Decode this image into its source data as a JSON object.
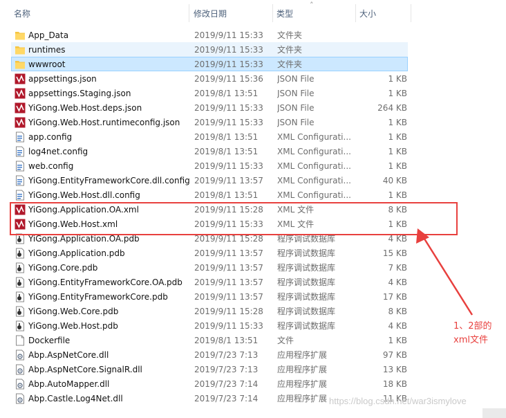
{
  "header": {
    "name": "名称",
    "date": "修改日期",
    "type": "类型",
    "size": "大小"
  },
  "files": [
    {
      "icon": "folder-icon",
      "name": "App_Data",
      "date": "2019/9/11 15:33",
      "type": "文件夹",
      "size": ""
    },
    {
      "icon": "folder-icon",
      "name": "runtimes",
      "date": "2019/9/11 15:33",
      "type": "文件夹",
      "size": ""
    },
    {
      "icon": "folder-icon",
      "name": "wwwroot",
      "date": "2019/9/11 15:33",
      "type": "文件夹",
      "size": ""
    },
    {
      "icon": "vs-file-icon",
      "name": "appsettings.json",
      "date": "2019/9/11 15:36",
      "type": "JSON File",
      "size": "1 KB"
    },
    {
      "icon": "vs-file-icon",
      "name": "appsettings.Staging.json",
      "date": "2019/8/1 13:51",
      "type": "JSON File",
      "size": "1 KB"
    },
    {
      "icon": "vs-file-icon",
      "name": "YiGong.Web.Host.deps.json",
      "date": "2019/9/11 15:33",
      "type": "JSON File",
      "size": "264 KB"
    },
    {
      "icon": "vs-file-icon",
      "name": "YiGong.Web.Host.runtimeconfig.json",
      "date": "2019/9/11 15:33",
      "type": "JSON File",
      "size": "1 KB"
    },
    {
      "icon": "config-file-icon",
      "name": "app.config",
      "date": "2019/8/1 13:51",
      "type": "XML Configurati...",
      "size": "1 KB"
    },
    {
      "icon": "config-file-icon",
      "name": "log4net.config",
      "date": "2019/8/1 13:51",
      "type": "XML Configurati...",
      "size": "1 KB"
    },
    {
      "icon": "config-file-icon",
      "name": "web.config",
      "date": "2019/9/11 15:33",
      "type": "XML Configurati...",
      "size": "1 KB"
    },
    {
      "icon": "config-file-icon",
      "name": "YiGong.EntityFrameworkCore.dll.config",
      "date": "2019/9/11 13:57",
      "type": "XML Configurati...",
      "size": "40 KB"
    },
    {
      "icon": "config-file-icon",
      "name": "YiGong.Web.Host.dll.config",
      "date": "2019/8/1 13:51",
      "type": "XML Configurati...",
      "size": "1 KB"
    },
    {
      "icon": "vs-file-icon",
      "name": "YiGong.Application.OA.xml",
      "date": "2019/9/11 15:28",
      "type": "XML 文件",
      "size": "8 KB"
    },
    {
      "icon": "vs-file-icon",
      "name": "YiGong.Web.Host.xml",
      "date": "2019/9/11 15:33",
      "type": "XML 文件",
      "size": "1 KB"
    },
    {
      "icon": "pdb-file-icon",
      "name": "YiGong.Application.OA.pdb",
      "date": "2019/9/11 15:28",
      "type": "程序调试数据库",
      "size": "4 KB"
    },
    {
      "icon": "pdb-file-icon",
      "name": "YiGong.Application.pdb",
      "date": "2019/9/11 13:57",
      "type": "程序调试数据库",
      "size": "15 KB"
    },
    {
      "icon": "pdb-file-icon",
      "name": "YiGong.Core.pdb",
      "date": "2019/9/11 13:57",
      "type": "程序调试数据库",
      "size": "7 KB"
    },
    {
      "icon": "pdb-file-icon",
      "name": "YiGong.EntityFrameworkCore.OA.pdb",
      "date": "2019/9/11 13:57",
      "type": "程序调试数据库",
      "size": "4 KB"
    },
    {
      "icon": "pdb-file-icon",
      "name": "YiGong.EntityFrameworkCore.pdb",
      "date": "2019/9/11 13:57",
      "type": "程序调试数据库",
      "size": "17 KB"
    },
    {
      "icon": "pdb-file-icon",
      "name": "YiGong.Web.Core.pdb",
      "date": "2019/9/11 15:28",
      "type": "程序调试数据库",
      "size": "8 KB"
    },
    {
      "icon": "pdb-file-icon",
      "name": "YiGong.Web.Host.pdb",
      "date": "2019/9/11 15:33",
      "type": "程序调试数据库",
      "size": "4 KB"
    },
    {
      "icon": "blank-file-icon",
      "name": "Dockerfile",
      "date": "2019/8/1 13:51",
      "type": "文件",
      "size": "1 KB"
    },
    {
      "icon": "dll-file-icon",
      "name": "Abp.AspNetCore.dll",
      "date": "2019/7/23 7:13",
      "type": "应用程序扩展",
      "size": "97 KB"
    },
    {
      "icon": "dll-file-icon",
      "name": "Abp.AspNetCore.SignalR.dll",
      "date": "2019/7/23 7:13",
      "type": "应用程序扩展",
      "size": "13 KB"
    },
    {
      "icon": "dll-file-icon",
      "name": "Abp.AutoMapper.dll",
      "date": "2019/7/23 7:14",
      "type": "应用程序扩展",
      "size": "18 KB"
    },
    {
      "icon": "dll-file-icon",
      "name": "Abp.Castle.Log4Net.dll",
      "date": "2019/7/23 7:14",
      "type": "应用程序扩展",
      "size": "11 KB"
    }
  ],
  "selection": {
    "hover_row": 1,
    "selected_row": 2
  },
  "annotation": {
    "line1": "1、2部的",
    "line2": "xml文件",
    "color": "#e8403e"
  },
  "watermark": "https://blog.csdn.net/war3ismylove"
}
